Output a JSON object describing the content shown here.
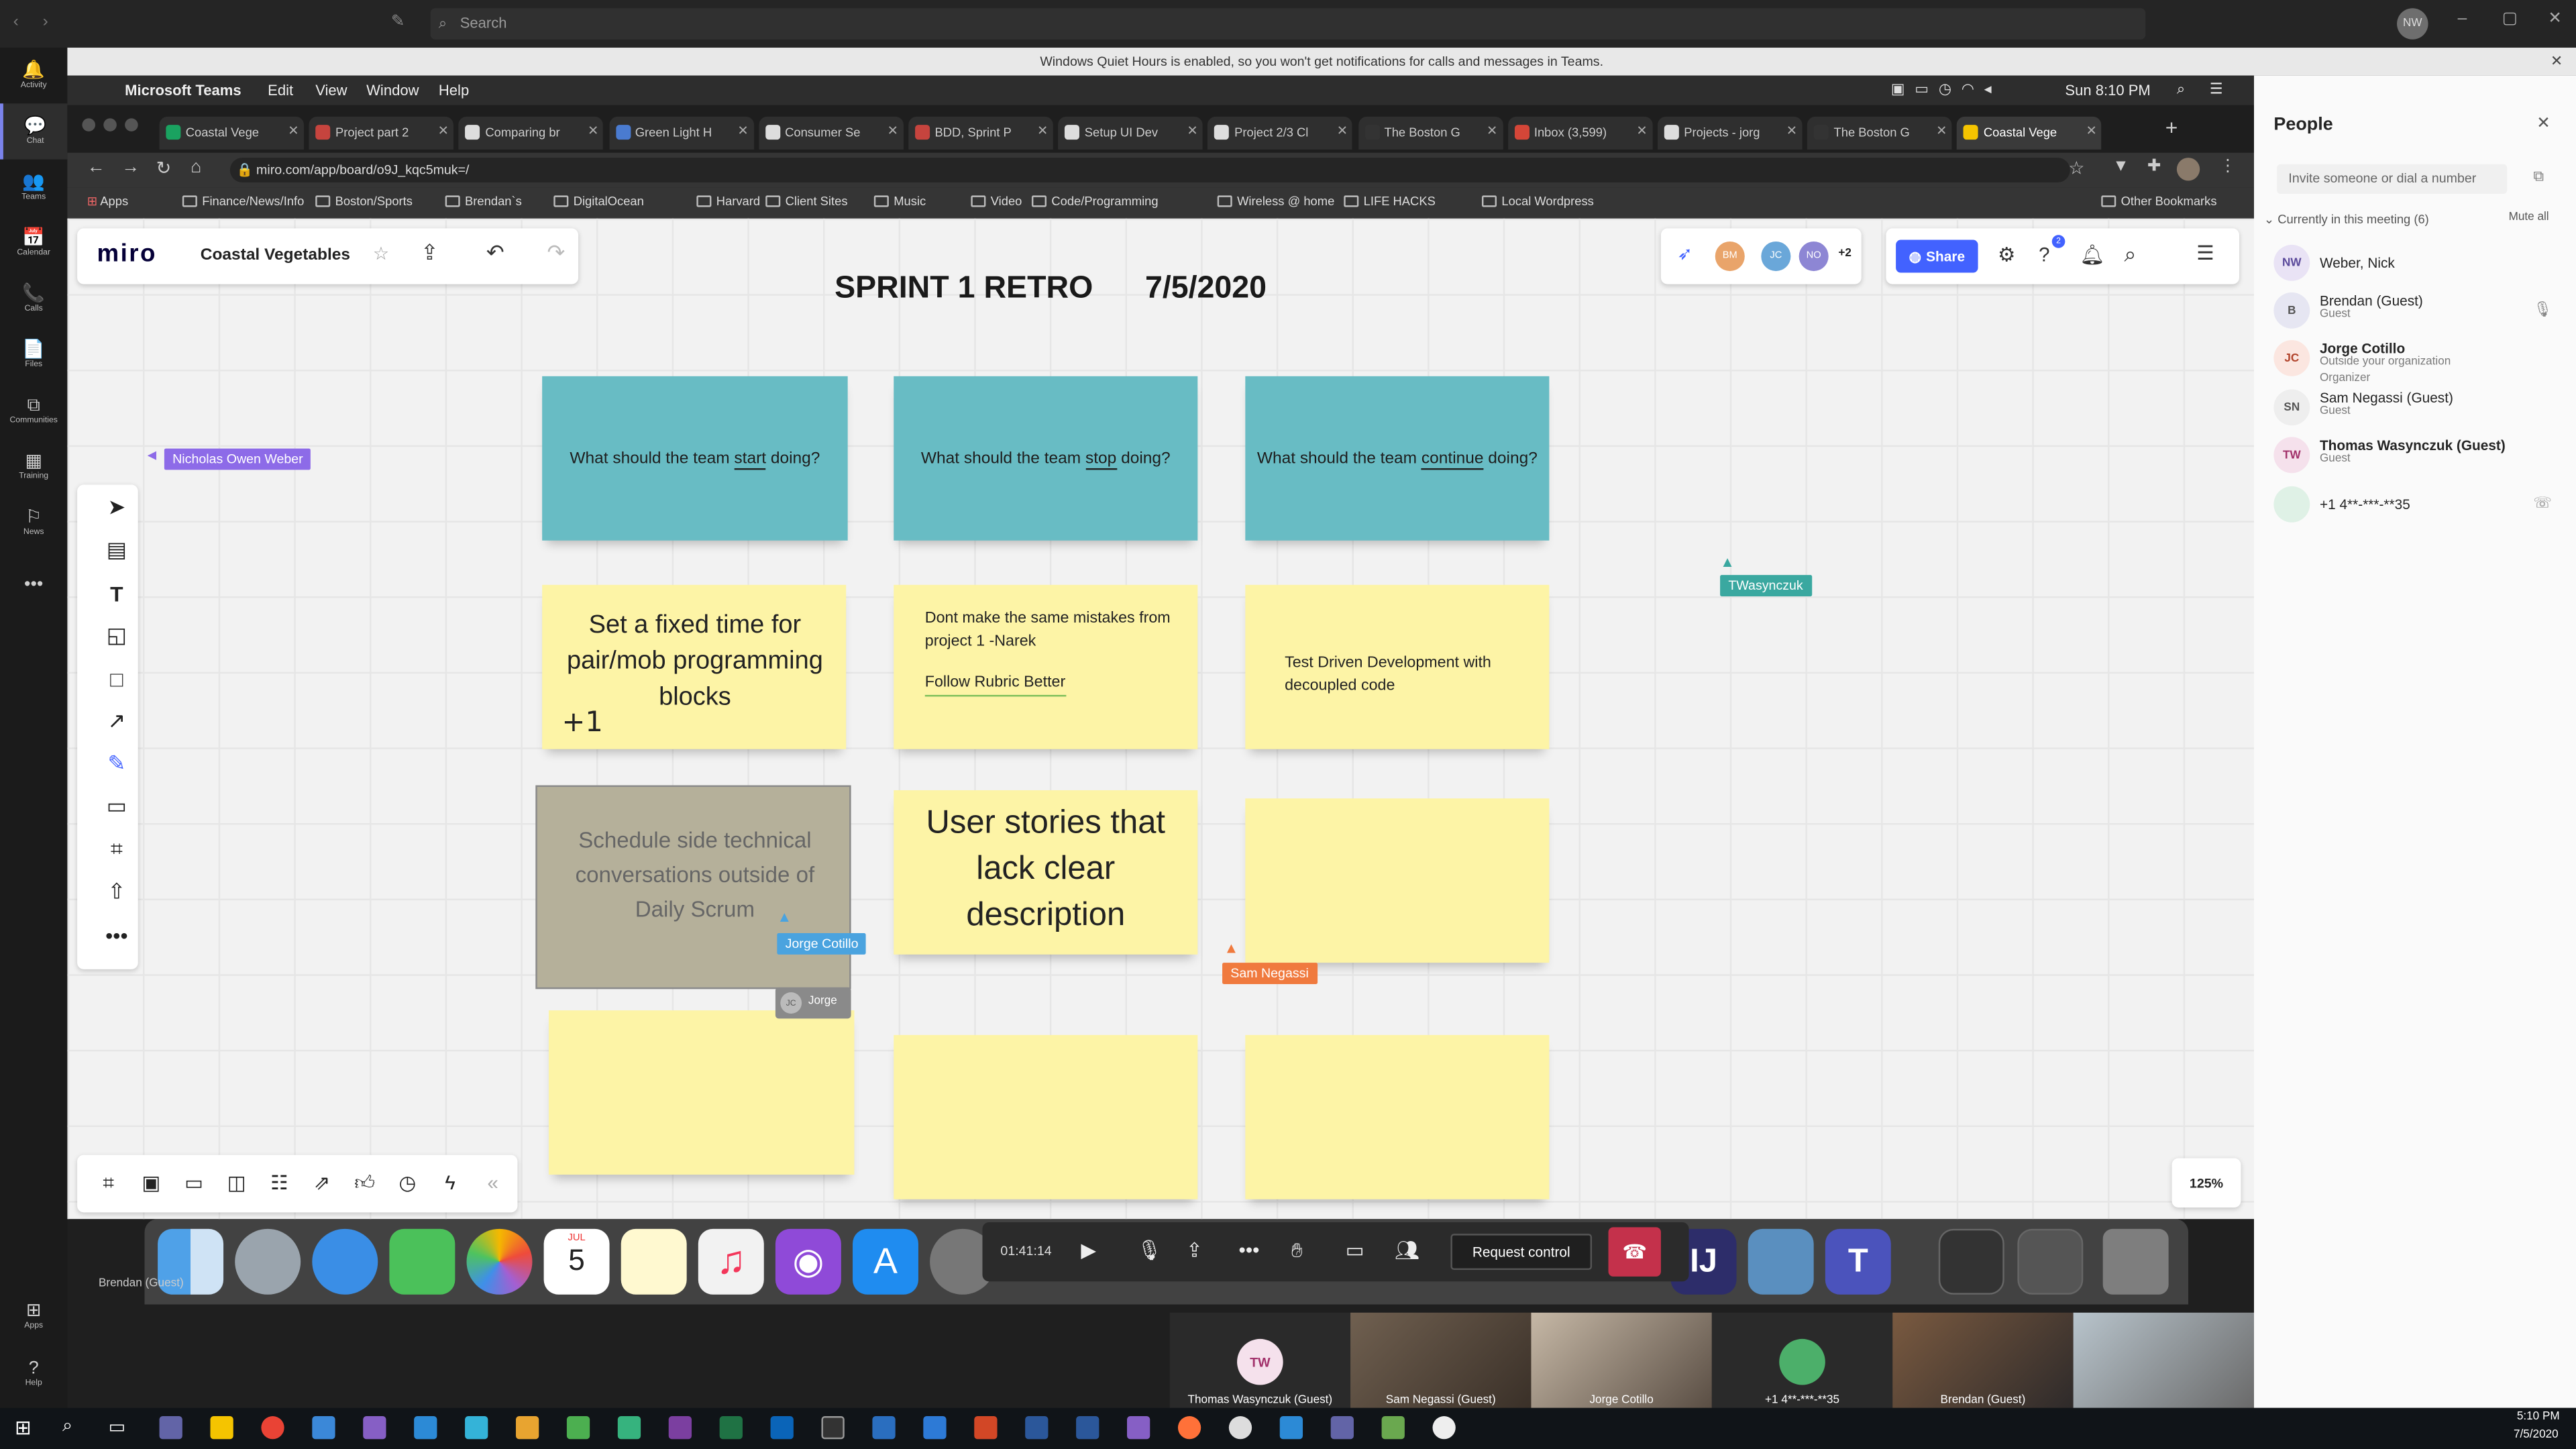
{
  "teams": {
    "search_placeholder": "Search",
    "user_initials": "NW",
    "quiet_hours": "Windows Quiet Hours is enabled, so you won't get notifications for calls and messages in Teams.",
    "rail": [
      {
        "label": "Activity",
        "icon": "bell-icon",
        "glyph": "🔔"
      },
      {
        "label": "Chat",
        "icon": "chat-icon",
        "glyph": "💬"
      },
      {
        "label": "Teams",
        "icon": "teams-icon",
        "glyph": "👥"
      },
      {
        "label": "Calendar",
        "icon": "calendar-icon",
        "glyph": "📅"
      },
      {
        "label": "Calls",
        "icon": "phone-icon",
        "glyph": "📞"
      },
      {
        "label": "Files",
        "icon": "file-icon",
        "glyph": "📄"
      },
      {
        "label": "Communities",
        "icon": "communities-icon",
        "glyph": "⧉"
      },
      {
        "label": "Training",
        "icon": "training-icon",
        "glyph": "▦"
      },
      {
        "label": "News",
        "icon": "news-icon",
        "glyph": "⚐"
      },
      {
        "label": "",
        "icon": "more-icon",
        "glyph": "•••"
      }
    ],
    "rail_bottom": [
      {
        "label": "Apps",
        "icon": "apps-icon",
        "glyph": "⊞"
      },
      {
        "label": "Help",
        "icon": "help-icon",
        "glyph": "?"
      }
    ]
  },
  "mac_menu": {
    "app": "Microsoft Teams",
    "items": [
      "Edit",
      "View",
      "Window",
      "Help"
    ],
    "clock": "Sun 8:10 PM"
  },
  "browser": {
    "tabs": [
      {
        "title": "Coastal Vege",
        "color": "#1aa260"
      },
      {
        "title": "Project part 2",
        "color": "#c6443e"
      },
      {
        "title": "Comparing br",
        "color": "#dddddd"
      },
      {
        "title": "Green Light H",
        "color": "#4a7bd0"
      },
      {
        "title": "Consumer Se",
        "color": "#dddddd"
      },
      {
        "title": "BDD, Sprint P",
        "color": "#c6443e"
      },
      {
        "title": "Setup UI Dev",
        "color": "#dddddd"
      },
      {
        "title": "Project 2/3 Cl",
        "color": "#dddddd"
      },
      {
        "title": "The Boston G",
        "color": "#333333"
      },
      {
        "title": "Inbox (3,599)",
        "color": "#d44638"
      },
      {
        "title": "Projects - jorg",
        "color": "#dddddd"
      },
      {
        "title": "The Boston G",
        "color": "#333333"
      },
      {
        "title": "Coastal Vege",
        "color": "#f5c400"
      }
    ],
    "url": "miro.com/app/board/o9J_kqc5muk=/",
    "bookmarks": [
      "Apps",
      "Finance/News/Info",
      "Boston/Sports",
      "Brendan`s",
      "DigitalOcean",
      "Harvard",
      "Client Sites",
      "Music",
      "Video",
      "Code/Programming",
      "Wireless @ home",
      "LIFE HACKS",
      "Local Wordpress"
    ],
    "other_bookmarks": "Other Bookmarks"
  },
  "miro": {
    "logo": "miro",
    "board_name": "Coastal Vegetables",
    "title": "SPRINT 1 RETRO",
    "date": "7/5/2020",
    "collaborators": [
      "BM",
      "JC",
      "NO"
    ],
    "collab_more": "+2",
    "share": "Share",
    "notif_count": "2",
    "zoom": "125%",
    "headers": [
      {
        "pre": "What should the team ",
        "key": "start",
        "post": " doing?"
      },
      {
        "pre": "What should the team ",
        "key": "stop",
        "post": " doing?"
      },
      {
        "pre": "What should the team ",
        "key": "continue",
        "post": " doing?"
      }
    ],
    "notes": {
      "n1": "Set a fixed time for pair/mob programming blocks",
      "n1_vote": "+1",
      "n2_line1": "Dont make the same mistakes from project 1 -Narek",
      "n2_line2": "Follow Rubric Better",
      "n3": "Test Driven Development with decoupled code",
      "n4": "Schedule side technical conversations outside of Daily Scrum",
      "n5": "User stories that lack clear description"
    },
    "cursors": {
      "nicholas": "Nicholas Owen Weber",
      "twasynczuk": "TWasynczuk",
      "jorge": "Jorge Cotillo",
      "jorge_short": "Jorge",
      "jorge_initials": "JC",
      "sam": "Sam Negassi"
    }
  },
  "people": {
    "title": "People",
    "invite_placeholder": "Invite someone or dial a number",
    "section": "Currently in this meeting (6)",
    "mute_all": "Mute all",
    "members": [
      {
        "initials": "NW",
        "name": "Weber, Nick",
        "sub1": "",
        "sub2": "",
        "color": "#e9e3f5",
        "fg": "#5b4a9b"
      },
      {
        "initials": "B",
        "name": "Brendan (Guest)",
        "sub1": "Guest",
        "sub2": "",
        "color": "#e6e6f2",
        "fg": "#555"
      },
      {
        "initials": "JC",
        "name": "Jorge Cotillo",
        "sub1": "Outside your organization",
        "sub2": "Organizer",
        "color": "#fbe6e0",
        "fg": "#b2442c"
      },
      {
        "initials": "SN",
        "name": "Sam Negassi (Guest)",
        "sub1": "Guest",
        "sub2": "",
        "color": "#eeeeee",
        "fg": "#555"
      },
      {
        "initials": "TW",
        "name": "Thomas Wasynczuk (Guest)",
        "sub1": "Guest",
        "sub2": "",
        "color": "#f5e1ec",
        "fg": "#a2326b"
      },
      {
        "initials": "",
        "name": "+1 4**-***-**35",
        "sub1": "",
        "sub2": "",
        "color": "#dff1e6",
        "fg": "#3a8a57"
      }
    ]
  },
  "call": {
    "timer": "01:41:14",
    "request_control": "Request control"
  },
  "dock": {
    "calendar_month": "JUL",
    "calendar_day": "5",
    "teams_label": "Brendan (Guest)"
  },
  "video": [
    {
      "initials": "TW",
      "name": "Thomas Wasynczuk (Guest)"
    },
    {
      "name": "Sam Negassi (Guest)"
    },
    {
      "name": "Jorge Cotillo"
    },
    {
      "name": "+1 4**-***-**35"
    },
    {
      "name": "Brendan (Guest)"
    },
    {
      "name": ""
    }
  ],
  "taskbar": {
    "time": "5:10 PM",
    "date": "7/5/2020"
  }
}
